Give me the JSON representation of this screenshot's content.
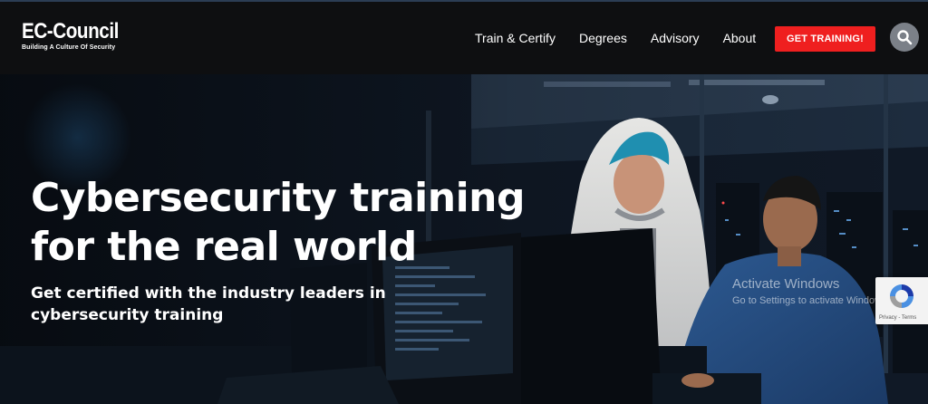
{
  "header": {
    "logo_title": "EC-Council",
    "logo_tagline": "Building A Culture Of Security",
    "nav": [
      "Train & Certify",
      "Degrees",
      "Advisory",
      "About"
    ],
    "cta_label": "GET TRAINING!",
    "search_icon": "search-icon"
  },
  "hero": {
    "title_line1": "Cybersecurity training",
    "title_line2": "for the real world",
    "subtitle_line1": "Get certified with the industry leaders in",
    "subtitle_line2": "cybersecurity training"
  },
  "overlay": {
    "activate_title": "Activate Windows",
    "activate_sub": "Go to Settings to activate Windows.",
    "recaptcha_links": "Privacy - Terms"
  },
  "colors": {
    "accent": "#ef1f1f",
    "header_bg": "#0e0f11",
    "hero_bg": "#172536"
  }
}
